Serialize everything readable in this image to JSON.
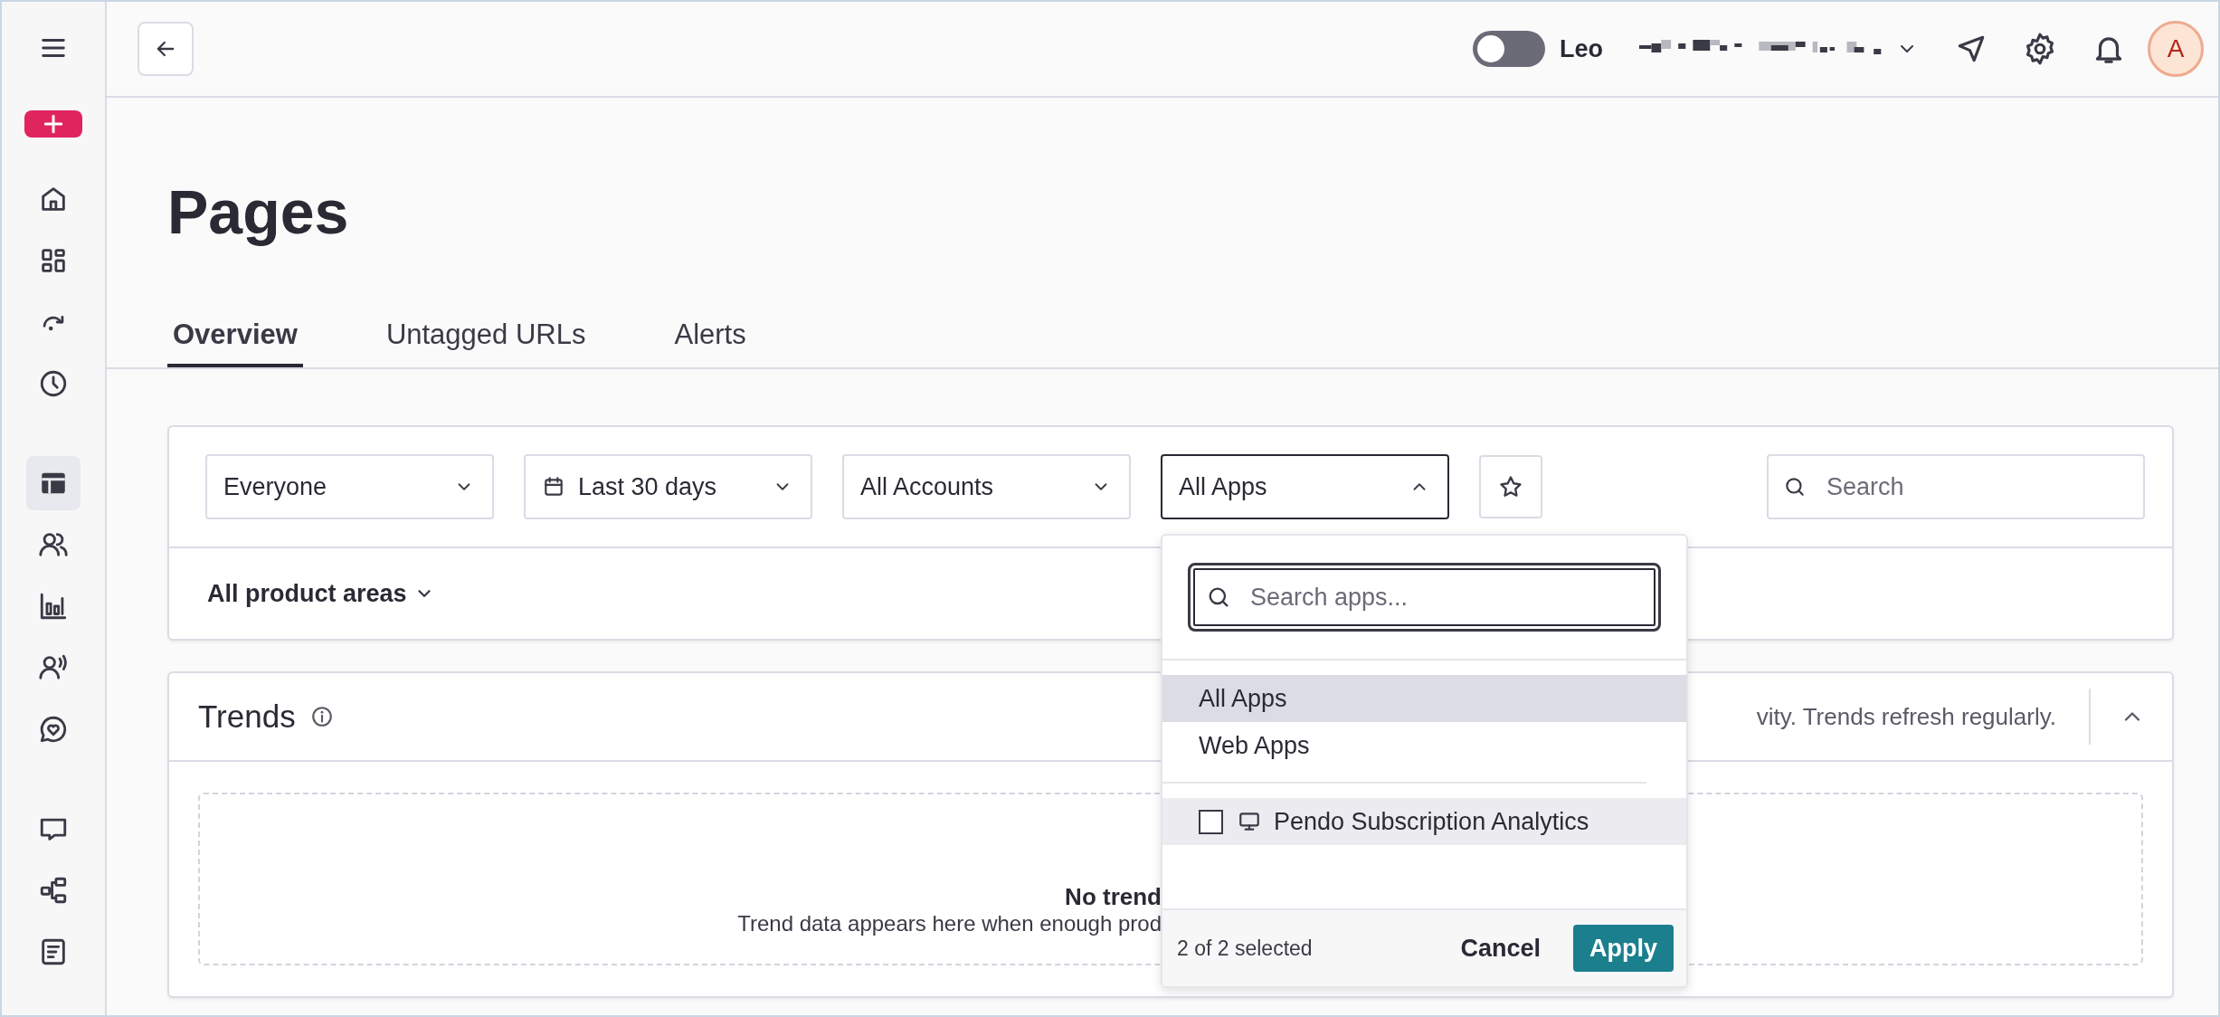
{
  "sidebar": {
    "groups": [
      {
        "items": [
          {
            "selected": false
          },
          {
            "selected": false
          },
          {
            "selected": false
          },
          {
            "selected": false
          }
        ]
      },
      {
        "items": [
          {
            "selected": true
          },
          {
            "selected": false
          },
          {
            "selected": false
          },
          {
            "selected": false
          },
          {
            "selected": false
          }
        ]
      },
      {
        "items": [
          {
            "selected": false
          },
          {
            "selected": false
          },
          {
            "selected": false
          }
        ]
      }
    ]
  },
  "top_bar": {
    "toggle": {
      "label": "Leo",
      "on": false
    },
    "avatar": "A"
  },
  "page_title": "Pages",
  "tabs": [
    {
      "label": "Overview",
      "selected": true
    },
    {
      "label": "Untagged URLs",
      "selected": false
    },
    {
      "label": "Alerts",
      "selected": false
    }
  ],
  "filters": [
    {
      "kind": "dropdown",
      "label": "Everyone",
      "expanded": false
    },
    {
      "kind": "date",
      "label": "Last 30 days",
      "expanded": false
    },
    {
      "kind": "dropdown",
      "label": "All Accounts",
      "expanded": false
    },
    {
      "kind": "dropdown",
      "label": "All Apps",
      "expanded": true
    }
  ],
  "search": {
    "placeholder": "Search"
  },
  "product_areas": "All product areas",
  "trends": {
    "title": "Trends",
    "description": "vity. Trends refresh regularly.",
    "expanded": true,
    "empty_title": "No trend",
    "empty_text": "Trend data appears here when enough prod"
  },
  "apps_menu": {
    "search_placeholder": "Search apps...",
    "options": [
      {
        "label": "All Apps",
        "selected": true
      },
      {
        "label": "Web Apps",
        "selected": false
      }
    ],
    "apps": [
      {
        "label": "Pendo Subscription Analytics",
        "checked": false,
        "hovered": true
      }
    ],
    "count": "2 of 2 selected",
    "cancel": "Cancel",
    "apply": "Apply"
  }
}
